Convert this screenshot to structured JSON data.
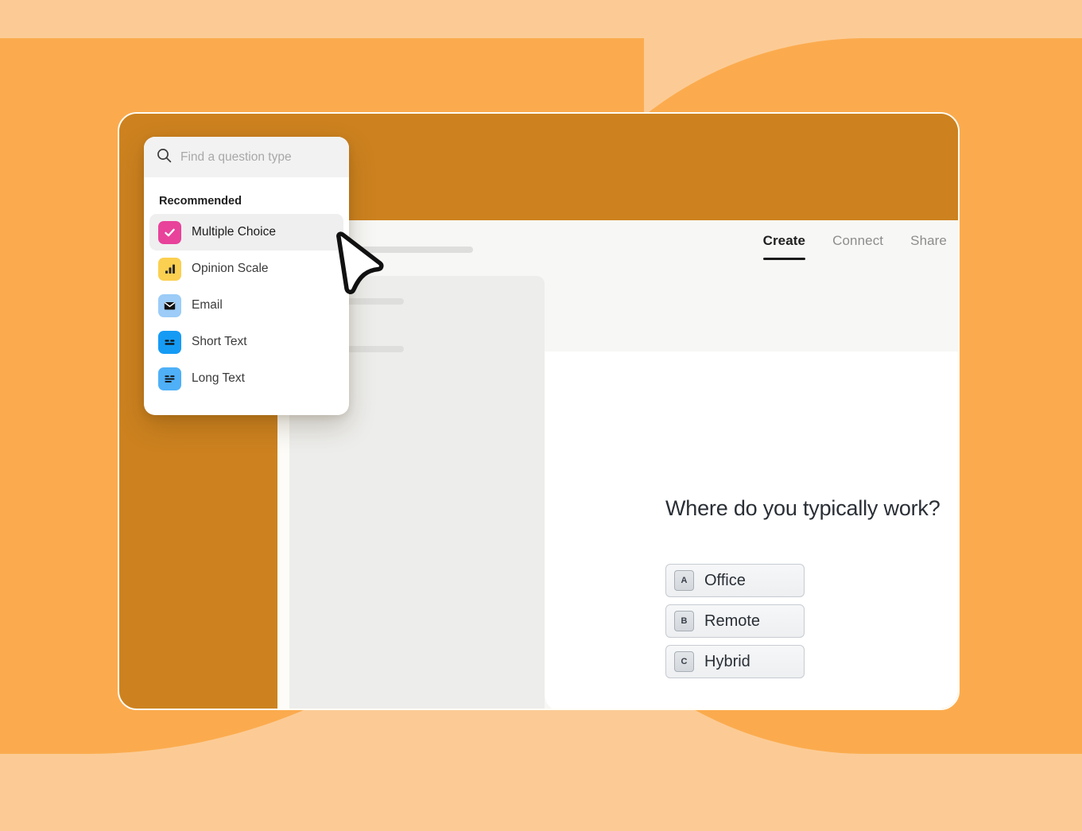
{
  "background": {
    "page_color": "#FCCB95",
    "blob_color": "#FBAB4E",
    "window_frame_color": "#CD821F"
  },
  "app_window": {
    "nav_tabs": [
      {
        "label": "Create",
        "active": true,
        "name": "tab-create"
      },
      {
        "label": "Connect",
        "active": false,
        "name": "tab-connect"
      },
      {
        "label": "Share",
        "active": false,
        "name": "tab-share"
      }
    ]
  },
  "question_type_popover": {
    "search": {
      "placeholder": "Find a question type",
      "value": "",
      "icon": "search-icon"
    },
    "section_heading": "Recommended",
    "items": [
      {
        "label": "Multiple Choice",
        "icon": "checkmark-icon",
        "icon_bg": "#E8429B",
        "selected": true
      },
      {
        "label": "Opinion Scale",
        "icon": "bar-chart-icon",
        "icon_bg": "#FBCF50",
        "selected": false
      },
      {
        "label": "Email",
        "icon": "envelope-icon",
        "icon_bg": "#9CCCF7",
        "selected": false
      },
      {
        "label": "Short Text",
        "icon": "short-text-icon",
        "icon_bg": "#169BF5",
        "selected": false
      },
      {
        "label": "Long Text",
        "icon": "long-text-icon",
        "icon_bg": "#4FB0F7",
        "selected": false
      }
    ]
  },
  "preview": {
    "question": "Where do you typically work?",
    "options": [
      {
        "key": "A",
        "label": "Office"
      },
      {
        "key": "B",
        "label": "Remote"
      },
      {
        "key": "C",
        "label": "Hybrid"
      }
    ]
  },
  "cursor": {
    "icon": "mouse-pointer-icon"
  }
}
